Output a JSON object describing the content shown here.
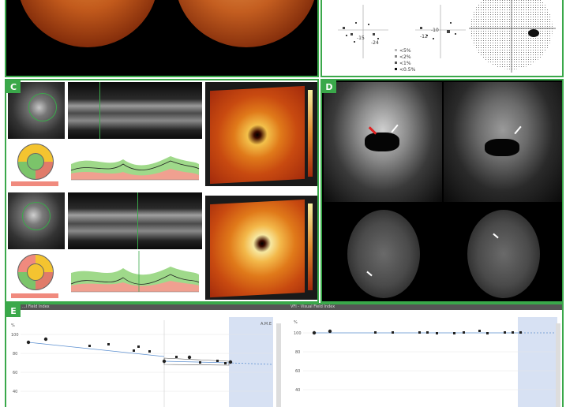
{
  "panels": {
    "C": {
      "label": "C"
    },
    "D": {
      "label": "D"
    },
    "E": {
      "label": "E"
    }
  },
  "visual_field_legend": [
    "<5%",
    "<2%",
    "<1%",
    "<0.5%"
  ],
  "visual_field_values": [
    "-15",
    "-24",
    "-12",
    "-10",
    "-14",
    "-28",
    "-9",
    "-18",
    "-24"
  ],
  "panel_e": {
    "left_header": "...l Field Index",
    "right_header": "VFI - Visual Field Index",
    "right_header_short": "VFI",
    "left_axis_label": "%",
    "right_axis_label": "%",
    "left_yticks": [
      "100",
      "80",
      "60",
      "40",
      "20"
    ],
    "right_yticks": [
      "100",
      "80",
      "60",
      "40",
      "20"
    ],
    "left_marker": "A.M.E",
    "colors": {
      "trend": "#5b8fd0",
      "shaded": "#d7e1f3"
    }
  }
}
